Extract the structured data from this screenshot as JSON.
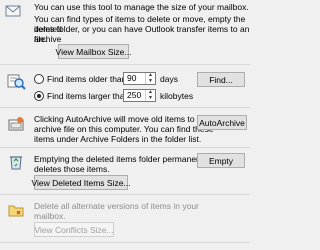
{
  "mailbox_cleanup": {
    "intro_line1": "You can use this tool to manage the size of your mailbox.",
    "intro_line2": "You can find types of items to delete or move, empty the deleted",
    "intro_line3": "items folder, or you can have Outlook transfer items to an archive",
    "intro_line4": "file.",
    "view_mailbox_size_label": "View Mailbox Size...",
    "find": {
      "older_label": "Find items older than",
      "older_value": "90",
      "older_unit": "days",
      "larger_label": "Find items larger than",
      "larger_value": "250",
      "larger_unit": "kilobytes",
      "find_button_label": "Find...",
      "selected_option": "larger"
    },
    "autoarchive": {
      "line1": "Clicking AutoArchive will move old items to the",
      "line2": "archive file on this computer. You can find these",
      "line3": "items under Archive Folders in the folder list.",
      "button_label": "AutoArchive"
    },
    "deleted_items": {
      "line1": "Emptying the deleted items folder permanently",
      "line2": "deletes those items.",
      "empty_button_label": "Empty",
      "view_size_label": "View Deleted Items Size..."
    },
    "conflicts": {
      "line1": "Delete all alternate versions of items in your",
      "line2": "mailbox.",
      "view_size_label": "View Conflicts Size..."
    }
  },
  "colors": {
    "background": "#f0f0f0",
    "accent": "#0078d7"
  }
}
